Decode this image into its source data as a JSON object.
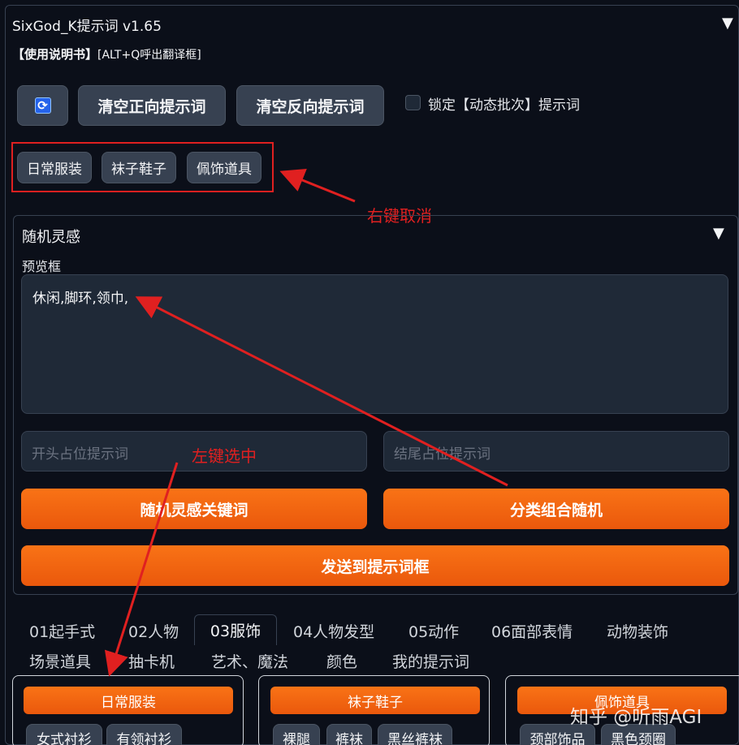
{
  "header": {
    "title": "SixGod_K提示词 v1.65",
    "collapse_icon": "▼",
    "manual_bold": "【使用说明书】",
    "manual_hint": "[ALT+Q呼出翻译框]"
  },
  "toolbar": {
    "refresh_icon": "🔄",
    "clear_positive_label": "清空正向提示词",
    "clear_negative_label": "清空反向提示词",
    "lock_checkbox_label": "锁定【动态批次】提示词",
    "lock_checked": false
  },
  "selected_chips": [
    "日常服装",
    "袜子鞋子",
    "佩饰道具"
  ],
  "annotations": {
    "right_click": "右键取消",
    "left_click": "左键选中",
    "color": "#e02020"
  },
  "inspiration": {
    "title": "随机灵感",
    "collapse_icon": "▼",
    "preview_label": "预览框",
    "preview_text": "休闲,脚环,领巾,",
    "start_placeholder": "开头占位提示词",
    "end_placeholder": "结尾占位提示词",
    "random_keyword_label": "随机灵感关键词",
    "category_random_label": "分类组合随机",
    "send_label": "发送到提示词框"
  },
  "tabs": {
    "row1": [
      "01起手式",
      "02人物",
      "03服饰",
      "04人物发型",
      "05动作",
      "06面部表情",
      "动物装饰"
    ],
    "row2": [
      "场景道具",
      "抽卡机",
      "艺术、魔法",
      "颜色",
      "我的提示词"
    ],
    "active": "03服饰"
  },
  "cards": [
    {
      "title": "日常服装",
      "tags": [
        "女式衬衫",
        "有领衬衫"
      ]
    },
    {
      "title": "袜子鞋子",
      "tags": [
        "裸腿",
        "裤袜",
        "黑丝裤袜"
      ]
    },
    {
      "title": "佩饰道具",
      "tags": [
        "颈部饰品",
        "黑色颈圈"
      ]
    }
  ],
  "watermark": "知乎 @听雨AGI",
  "colors": {
    "background": "#0b0f19",
    "button_gray": "#374151",
    "accent_orange": "#f97316",
    "annotation_red": "#e02020"
  }
}
